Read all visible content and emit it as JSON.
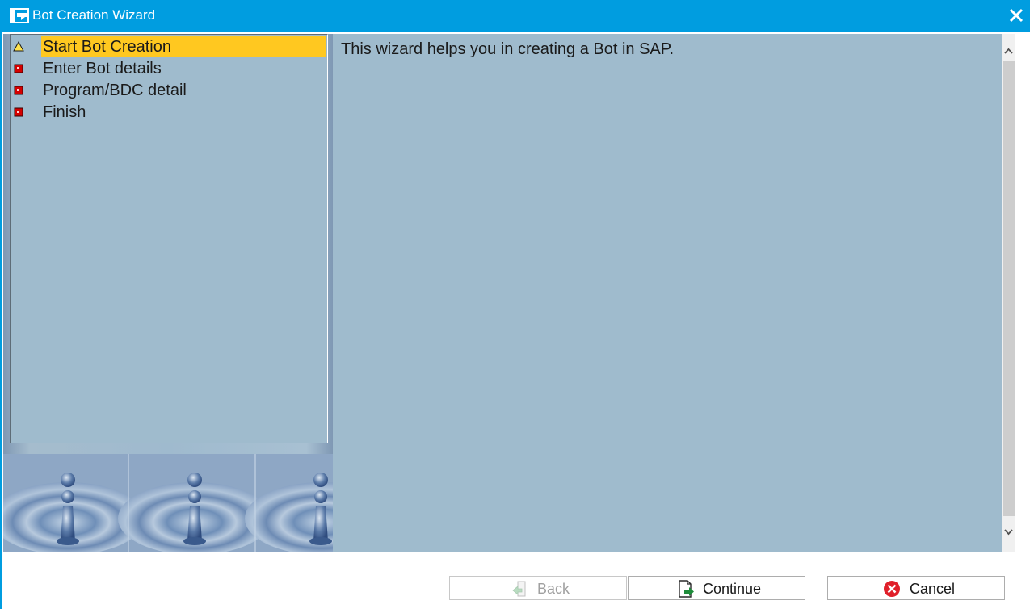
{
  "window": {
    "title": "Bot Creation Wizard"
  },
  "steps": [
    {
      "label": "Start Bot Creation",
      "status": "current"
    },
    {
      "label": "Enter Bot details",
      "status": "pending"
    },
    {
      "label": "Program/BDC detail",
      "status": "pending"
    },
    {
      "label": "Finish",
      "status": "pending"
    }
  ],
  "content": {
    "text": "This wizard helps you in creating a Bot in SAP."
  },
  "buttons": {
    "back": "Back",
    "continue": "Continue",
    "cancel": "Cancel"
  },
  "icons": {
    "title": "wizard-window-icon",
    "close": "close-icon",
    "current_step": "warning-triangle-icon",
    "pending_step": "red-square-icon",
    "back": "back-arrow-icon",
    "continue": "continue-document-icon",
    "cancel": "cancel-circle-icon"
  },
  "colors": {
    "titlebar": "#009de0",
    "panel_bg": "#9fbbcd",
    "active_step": "#ffc820",
    "pending_marker": "#d40000",
    "cancel_icon": "#e0202a",
    "continue_arrow": "#1e8c3a"
  }
}
